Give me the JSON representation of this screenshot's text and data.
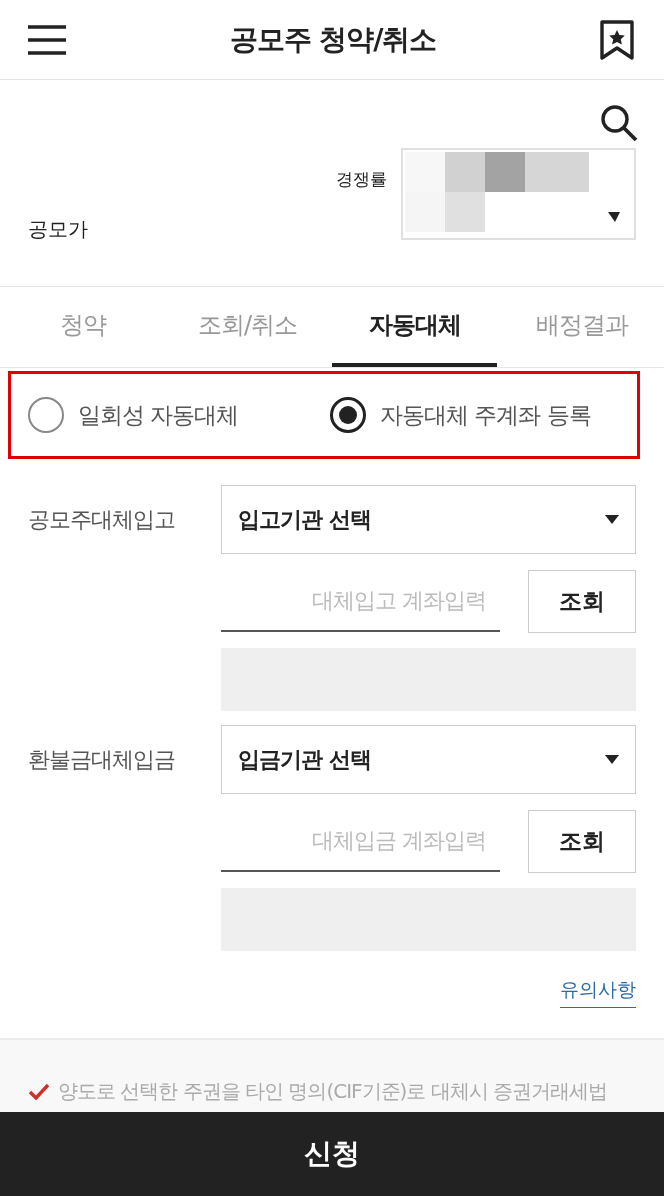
{
  "header": {
    "title": "공모주 청약/취소"
  },
  "summary": {
    "rate_label": "경쟁률",
    "price_label": "공모가"
  },
  "tabs": [
    {
      "label": "청약",
      "selected": false
    },
    {
      "label": "조회/취소",
      "selected": false
    },
    {
      "label": "자동대체",
      "selected": true
    },
    {
      "label": "배정결과",
      "selected": false
    }
  ],
  "options": [
    {
      "label": "일회성 자동대체",
      "selected": false
    },
    {
      "label": "자동대체 주계좌 등록",
      "selected": true
    }
  ],
  "groups": [
    {
      "label": "공모주대체입고",
      "institution": "입고기관 선택",
      "account_placeholder": "대체입고 계좌입력",
      "lookup": "조회"
    },
    {
      "label": "환불금대체입금",
      "institution": "입금기관 선택",
      "account_placeholder": "대체입금 계좌입력",
      "lookup": "조회"
    }
  ],
  "notice_link": "유의사항",
  "note": "양도로 선택한 주권을 타인 명의(CIF기준)로 대체시 증권거래세법",
  "submit": "신청"
}
